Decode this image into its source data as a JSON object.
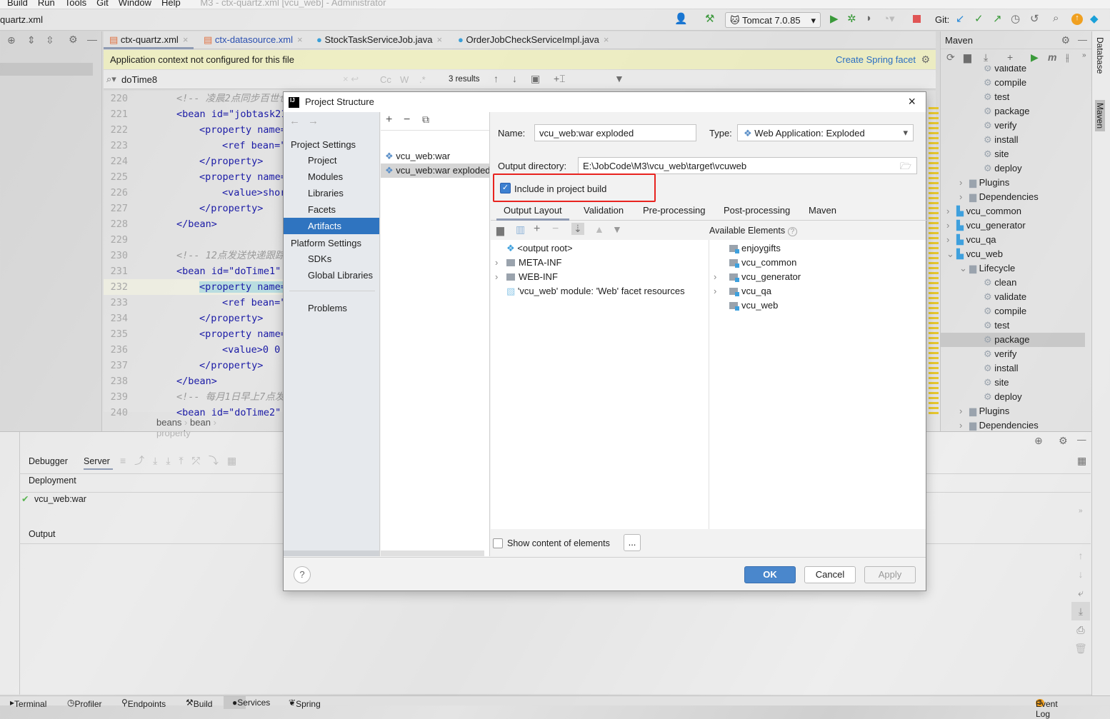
{
  "menu": {
    "items": [
      "Build",
      "Run",
      "Tools",
      "Git",
      "Window",
      "Help"
    ],
    "title": "M3 - ctx-quartz.xml [vcu_web] - Administrator"
  },
  "navbar": {
    "file": "quartz.xml"
  },
  "toolbar": {
    "run_config": "Tomcat 7.0.85",
    "git_label": "Git:",
    "icons": [
      "user-icon",
      "hammer-icon",
      "run-icon",
      "debug-icon",
      "coverage-icon",
      "profile-icon",
      "stop-icon",
      "git-update-icon",
      "git-commit-icon",
      "git-push-icon",
      "history-icon",
      "rollback-icon",
      "search-icon",
      "update-icon",
      "toolbox-icon"
    ]
  },
  "editor": {
    "tabs": [
      {
        "label": "ctx-quartz.xml",
        "active": true
      },
      {
        "label": "ctx-datasource.xml"
      },
      {
        "label": "StockTaskServiceJob.java"
      },
      {
        "label": "OrderJobCheckServiceImpl.java"
      }
    ],
    "banner": {
      "text": "Application context not configured for this file",
      "action": "Create Spring facet"
    },
    "find": {
      "query": "doTime8",
      "results": "3 results",
      "options": [
        "Cc",
        "W",
        ".*"
      ]
    },
    "lines": [
      {
        "n": "220",
        "indent": 0,
        "text": "<!-- 凌晨2点同步百世仓",
        "comment": true
      },
      {
        "n": "221",
        "indent": 0,
        "text": "<bean id=\"jobtask21"
      },
      {
        "n": "222",
        "indent": 1,
        "text": "<property name="
      },
      {
        "n": "223",
        "indent": 2,
        "text": "<ref bean=\""
      },
      {
        "n": "224",
        "indent": 1,
        "text": "</property>"
      },
      {
        "n": "225",
        "indent": 1,
        "text": "<property name="
      },
      {
        "n": "226",
        "indent": 2,
        "text": "<value>shor"
      },
      {
        "n": "227",
        "indent": 1,
        "text": "</property>"
      },
      {
        "n": "228",
        "indent": 0,
        "text": "</bean>"
      },
      {
        "n": "229",
        "indent": 0,
        "text": ""
      },
      {
        "n": "230",
        "indent": 0,
        "text": "<!-- 12点发送快递跟踪",
        "comment": true
      },
      {
        "n": "231",
        "indent": 0,
        "text": "<bean id=\"doTime1\""
      },
      {
        "n": "232",
        "indent": 1,
        "text": "<property name=",
        "current": true
      },
      {
        "n": "233",
        "indent": 2,
        "text": "<ref bean=\""
      },
      {
        "n": "234",
        "indent": 1,
        "text": "</property>"
      },
      {
        "n": "235",
        "indent": 1,
        "text": "<property name="
      },
      {
        "n": "236",
        "indent": 2,
        "text": "<value>0 0"
      },
      {
        "n": "237",
        "indent": 1,
        "text": "</property>"
      },
      {
        "n": "238",
        "indent": 0,
        "text": "</bean>"
      },
      {
        "n": "239",
        "indent": 0,
        "text": "<!-- 每月1日早上7点发",
        "comment": true
      },
      {
        "n": "240",
        "indent": 0,
        "text": "<bean id=\"doTime2\""
      }
    ],
    "breadcrumb": [
      "beans",
      "bean",
      "property"
    ]
  },
  "maven": {
    "title": "Maven",
    "tree": [
      {
        "label": "validate",
        "level": 3,
        "type": "goal"
      },
      {
        "label": "compile",
        "level": 3,
        "type": "goal"
      },
      {
        "label": "test",
        "level": 3,
        "type": "goal"
      },
      {
        "label": "package",
        "level": 3,
        "type": "goal"
      },
      {
        "label": "verify",
        "level": 3,
        "type": "goal"
      },
      {
        "label": "install",
        "level": 3,
        "type": "goal"
      },
      {
        "label": "site",
        "level": 3,
        "type": "goal"
      },
      {
        "label": "deploy",
        "level": 3,
        "type": "goal"
      },
      {
        "label": "Plugins",
        "level": 2,
        "type": "folder",
        "arrow": ">"
      },
      {
        "label": "Dependencies",
        "level": 2,
        "type": "folder",
        "arrow": ">"
      },
      {
        "label": "vcu_common",
        "level": 1,
        "type": "module",
        "arrow": ">"
      },
      {
        "label": "vcu_generator",
        "level": 1,
        "type": "module",
        "arrow": ">"
      },
      {
        "label": "vcu_qa",
        "level": 1,
        "type": "module",
        "arrow": ">"
      },
      {
        "label": "vcu_web",
        "level": 1,
        "type": "module",
        "arrow": "v"
      },
      {
        "label": "Lifecycle",
        "level": 2,
        "type": "folder",
        "arrow": "v"
      },
      {
        "label": "clean",
        "level": 3,
        "type": "goal"
      },
      {
        "label": "validate",
        "level": 3,
        "type": "goal"
      },
      {
        "label": "compile",
        "level": 3,
        "type": "goal"
      },
      {
        "label": "test",
        "level": 3,
        "type": "goal"
      },
      {
        "label": "package",
        "level": 3,
        "type": "goal",
        "selected": true
      },
      {
        "label": "verify",
        "level": 3,
        "type": "goal"
      },
      {
        "label": "install",
        "level": 3,
        "type": "goal"
      },
      {
        "label": "site",
        "level": 3,
        "type": "goal"
      },
      {
        "label": "deploy",
        "level": 3,
        "type": "goal"
      },
      {
        "label": "Plugins",
        "level": 2,
        "type": "folder",
        "arrow": ">"
      },
      {
        "label": "Dependencies",
        "level": 2,
        "type": "folder",
        "arrow": ">"
      }
    ]
  },
  "side_tabs": [
    "Database",
    "Maven"
  ],
  "services": {
    "tabs": [
      "Debugger",
      "Server"
    ],
    "active_tab": "Server",
    "deployment_label": "Deployment",
    "deployment_item": "vcu_web:war",
    "output_label": "Output"
  },
  "bottom_tabs": [
    "Terminal",
    "Profiler",
    "Endpoints",
    "Build",
    "Services",
    "Spring"
  ],
  "event_log": {
    "count": "3",
    "label": "Event Log"
  },
  "dialog": {
    "title": "Project Structure",
    "nav": {
      "project_settings": "Project Settings",
      "project_items": [
        "Project",
        "Modules",
        "Libraries",
        "Facets",
        "Artifacts"
      ],
      "selected": "Artifacts",
      "platform_settings": "Platform Settings",
      "platform_items": [
        "SDKs",
        "Global Libraries"
      ],
      "problems": "Problems"
    },
    "artifacts": [
      "vcu_web:war",
      "vcu_web:war exploded"
    ],
    "name_label": "Name:",
    "name_value": "vcu_web:war exploded",
    "type_label": "Type:",
    "type_value": "Web Application: Exploded",
    "output_label": "Output directory:",
    "output_value": "E:\\JobCode\\M3\\vcu_web\\target\\vcuweb",
    "include_label": "Include in project build",
    "include_checked": true,
    "tabs": [
      "Output Layout",
      "Validation",
      "Pre-processing",
      "Post-processing",
      "Maven"
    ],
    "active_tab": "Output Layout",
    "layout_tree": [
      {
        "label": "<output root>",
        "arrow": ""
      },
      {
        "label": "META-INF",
        "arrow": ">"
      },
      {
        "label": "WEB-INF",
        "arrow": ">"
      },
      {
        "label": "'vcu_web' module: 'Web' facet resources",
        "arrow": ""
      }
    ],
    "available_label": "Available Elements",
    "available": [
      {
        "label": "enjoygifts",
        "arrow": ""
      },
      {
        "label": "vcu_common",
        "arrow": ""
      },
      {
        "label": "vcu_generator",
        "arrow": ">"
      },
      {
        "label": "vcu_qa",
        "arrow": ">"
      },
      {
        "label": "vcu_web",
        "arrow": ""
      }
    ],
    "show_content_label": "Show content of elements",
    "show_content_checked": false,
    "more_label": "...",
    "ok": "OK",
    "cancel": "Cancel",
    "apply": "Apply",
    "help": "?"
  },
  "colors": {
    "accent": "#2f74c0",
    "highlight_box": "#e8231f",
    "banner": "#f0f0be",
    "ok_button": "#4a87cc"
  }
}
